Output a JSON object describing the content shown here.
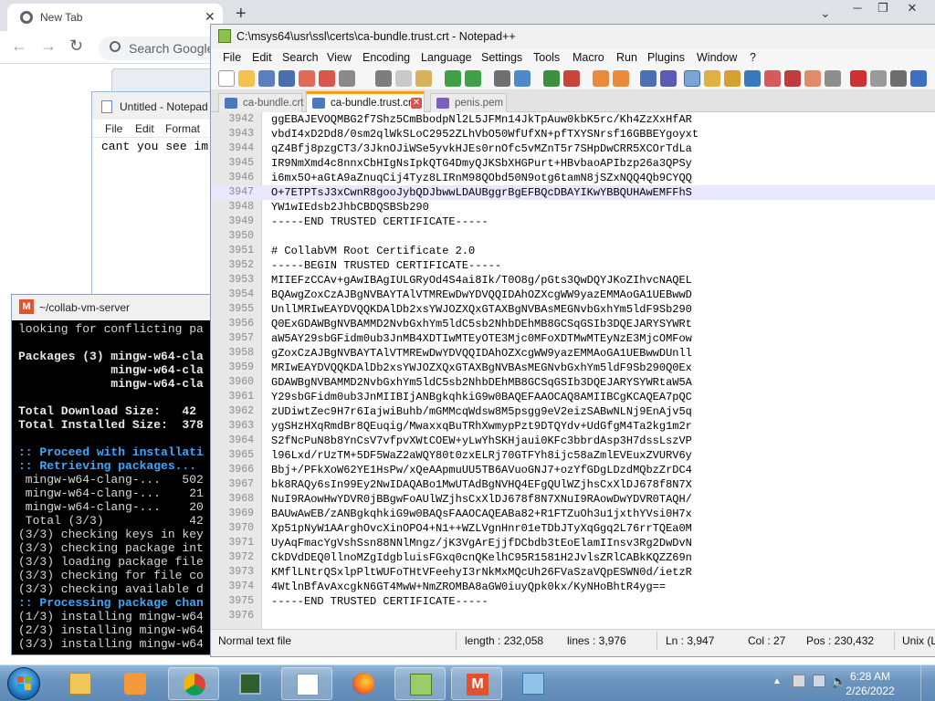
{
  "chrome": {
    "tab_title": "New Tab",
    "new_tab_glyph": "+",
    "search_placeholder": "Search Google or type a URL"
  },
  "notepad": {
    "title": "Untitled - Notepad",
    "menu": [
      "File",
      "Edit",
      "Format"
    ],
    "text": "cant you see im"
  },
  "terminal": {
    "title": "~/collab-vm-server",
    "lines": [
      {
        "text": "looking for conflicting pa",
        "style": "tg"
      },
      {
        "text": "",
        "style": "tg"
      },
      {
        "text": "Packages (3) mingw-w64-cla",
        "style": "tw"
      },
      {
        "text": "             mingw-w64-cla",
        "style": "tw"
      },
      {
        "text": "             mingw-w64-cla",
        "style": "tw"
      },
      {
        "text": "",
        "style": "tg"
      },
      {
        "text": "Total Download Size:   42",
        "style": "tw"
      },
      {
        "text": "Total Installed Size:  378",
        "style": "tw"
      },
      {
        "text": "",
        "style": "tg"
      },
      {
        "text": ":: Proceed with installati",
        "style": "tc"
      },
      {
        "text": ":: Retrieving packages...",
        "style": "tc"
      },
      {
        "text": " mingw-w64-clang-...   502",
        "style": "tg"
      },
      {
        "text": " mingw-w64-clang-...    21",
        "style": "tg"
      },
      {
        "text": " mingw-w64-clang-...    20",
        "style": "tg"
      },
      {
        "text": " Total (3/3)            42",
        "style": "tg"
      },
      {
        "text": "(3/3) checking keys in key",
        "style": "tg"
      },
      {
        "text": "(3/3) checking package int",
        "style": "tg"
      },
      {
        "text": "(3/3) loading package file",
        "style": "tg"
      },
      {
        "text": "(3/3) checking for file co",
        "style": "tg"
      },
      {
        "text": "(3/3) checking available d",
        "style": "tg"
      },
      {
        "text": ":: Processing package chan",
        "style": "tc"
      },
      {
        "text": "(1/3) installing mingw-w64",
        "style": "tg"
      },
      {
        "text": "(2/3) installing mingw-w64",
        "style": "tg"
      },
      {
        "text": "(3/3) installing mingw-w64",
        "style": "tg"
      }
    ]
  },
  "npp": {
    "title": "C:\\msys64\\usr\\ssl\\certs\\ca-bundle.trust.crt - Notepad++",
    "menu": [
      "File",
      "Edit",
      "Search",
      "View",
      "Encoding",
      "Language",
      "Settings",
      "Tools",
      "Macro",
      "Run",
      "Plugins",
      "Window",
      "?"
    ],
    "tabs": [
      {
        "label": "ca-bundle.crt",
        "active": false
      },
      {
        "label": "ca-bundle.trust.crt",
        "active": true
      },
      {
        "label": "penis.pem",
        "active": false
      }
    ],
    "highlight_line": 3947,
    "lines": [
      {
        "n": "3942",
        "t": "ggEBAJEVOQMBG2f7Shz5CmBbodpNl2L5JFMn14JkTpAuw0kbK5rc/Kh4ZzXxHfAR"
      },
      {
        "n": "3943",
        "t": "vbdI4xD2Dd8/0sm2qlWkSLoC2952ZLhVbO50WfUfXN+pfTXYSNrsf16GBBEYgoyxt"
      },
      {
        "n": "3944",
        "t": "qZ4Bfj8pzgCT3/3JknOJiWSe5yvkHJEs0rnOfc5vMZnT5r7SHpDwCRR5XCOrTdLa"
      },
      {
        "n": "3945",
        "t": "IR9NmXmd4c8nnxCbHIgNsIpkQTG4DmyQJKSbXHGPurt+HBvbaoAPIbzp26a3QPSy"
      },
      {
        "n": "3946",
        "t": "i6mx5O+aGtA9aZnuqCij4Tyz8LIRnM98QObd50N9otg6tamN8jSZxNQQ4Qb9CYQQ"
      },
      {
        "n": "3947",
        "t": "O+7ETPTsJ3xCwnR8gooJybQDJbwwLDAUBggrBgEFBQcDBAYIKwYBBQUHAwEMFFhS"
      },
      {
        "n": "3948",
        "t": "YW1wIEdsb2JhbCBDQSBSb290"
      },
      {
        "n": "3949",
        "t": "-----END TRUSTED CERTIFICATE-----"
      },
      {
        "n": "3950",
        "t": ""
      },
      {
        "n": "3951",
        "t": "# CollabVM Root Certificate 2.0"
      },
      {
        "n": "3952",
        "t": "-----BEGIN TRUSTED CERTIFICATE-----"
      },
      {
        "n": "3953",
        "t": "MIIEFzCCAv+gAwIBAgIULGRyOd4S4ai8Ik/T0O8g/pGts3QwDQYJKoZIhvcNAQEL"
      },
      {
        "n": "3954",
        "t": "BQAwgZoxCzAJBgNVBAYTAlVTMREwDwYDVQQIDAhOZXcgWW9yazEMMAoGA1UEBwwD"
      },
      {
        "n": "3955",
        "t": "UnllMRIwEAYDVQQKDAlDb2xsYWJOZXQxGTAXBgNVBAsMEGNvbGxhYm5ldF9Sb290"
      },
      {
        "n": "3956",
        "t": "Q0ExGDAWBgNVBAMMD2NvbGxhYm5ldC5sb2NhbDEhMB8GCSqGSIb3DQEJARYSYWRt"
      },
      {
        "n": "3957",
        "t": "aW5AY29sbGFidm0ub3JnMB4XDTIwMTEyOTE3Mjc0MFoXDTMwMTEyNzE3MjcOMFow"
      },
      {
        "n": "3958",
        "t": "gZoxCzAJBgNVBAYTAlVTMREwDwYDVQQIDAhOZXcgWW9yazEMMAoGA1UEBwwDUnll"
      },
      {
        "n": "3959",
        "t": "MRIwEAYDVQQKDAlDb2xsYWJOZXQxGTAXBgNVBAsMEGNvbGxhYm5ldF9Sb290Q0Ex"
      },
      {
        "n": "3960",
        "t": "GDAWBgNVBAMMD2NvbGxhYm5ldC5sb2NhbDEhMB8GCSqGSIb3DQEJARYSYWRtaW5A"
      },
      {
        "n": "3961",
        "t": "Y29sbGFidm0ub3JnMIIBIjANBgkqhkiG9w0BAQEFAAOCAQ8AMIIBCgKCAQEA7pQC"
      },
      {
        "n": "3962",
        "t": "zUDiwtZec9H7r6IajwiBuhb/mGMMcqWdsw8M5psgg9eV2eizSABwNLNj9EnAjv5q"
      },
      {
        "n": "3963",
        "t": "ygSHzHXqRmdBr8QEuqig/MwaxxqBuTRhXwmypPzt9DTQYdv+UdGfgM4Ta2kg1m2r"
      },
      {
        "n": "3964",
        "t": "S2fNcPuN8b8YnCsV7vfpvXWtCOEW+yLwYhSKHjaui0KFc3bbrdAsp3H7dssLszVP"
      },
      {
        "n": "3965",
        "t": "l96Lxd/rUzTM+5DF5WaZ2aWQY80t0zxELRj70GTFYh8ijc58aZmlEVEuxZVURV6y"
      },
      {
        "n": "3966",
        "t": "Bbj+/PFkXoW62YE1HsPw/xQeAApmuUU5TB6AVuoGNJ7+ozYfGDgLDzdMQbzZrDC4"
      },
      {
        "n": "3967",
        "t": "bk8RAQy6sIn99Ey2NwIDAQABo1MwUTAdBgNVHQ4EFgQUlWZjhsCxXlDJ678f8N7X"
      },
      {
        "n": "3968",
        "t": "NuI9RAowHwYDVR0jBBgwFoAUlWZjhsCxXlDJ678f8N7XNuI9RAowDwYDVR0TAQH/"
      },
      {
        "n": "3969",
        "t": "BAUwAwEB/zANBgkqhkiG9w0BAQsFAAOCAQEABa82+R1FTZuOh3u1jxthYVsi0H7x"
      },
      {
        "n": "3970",
        "t": "Xp51pNyW1AArghOvcXinOPO4+N1++WZLVgnHnr01eTDbJTyXqGgq2L76rrTQEa0M"
      },
      {
        "n": "3971",
        "t": "UyAqFmacYgVshSsn88NNlMngz/jK3VgArEjjfDCbdb3tEoElamIInsv3Rg2DwDvN"
      },
      {
        "n": "3972",
        "t": "CkDVdDEQ0llnoMZgIdgbluisFGxq0cnQKelhC95R1581H2JvlsZRlCABkKQZZ69n"
      },
      {
        "n": "3973",
        "t": "KMflLNtrQSxlpPltWUFoTHtVFeehyI3rNkMxMQcUh26FVaSzaVQpESWN0d/ietzR"
      },
      {
        "n": "3974",
        "t": "4WtlnBfAvAxcgkN6GT4MwW+NmZROMBA8aGW0iuyQpk0kx/KyNHoBhtR4yg=="
      },
      {
        "n": "3975",
        "t": "-----END TRUSTED CERTIFICATE-----"
      },
      {
        "n": "3976",
        "t": ""
      }
    ],
    "status": {
      "type": "Normal text file",
      "length": "length : 232,058",
      "lines": "lines : 3,976",
      "ln": "Ln : 3,947",
      "col": "Col : 27",
      "pos": "Pos : 230,432",
      "eol": "Unix (L"
    }
  },
  "taskbar": {
    "time": "6:28 AM",
    "date": "2/26/2022",
    "tray_arrow": "▲"
  }
}
